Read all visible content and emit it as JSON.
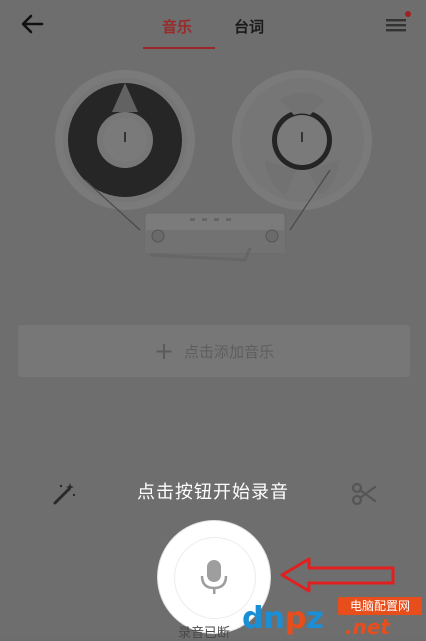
{
  "header": {
    "tabs": [
      {
        "label": "音乐",
        "active": true
      },
      {
        "label": "台词",
        "active": false
      }
    ]
  },
  "add_music": {
    "label": "点击添加音乐"
  },
  "record": {
    "hint": "点击按钮开始录音",
    "status": "录音已断"
  },
  "watermark": {
    "logo_parts": [
      "dn",
      "p",
      "z"
    ],
    "suffix": ".net",
    "site_name": "电脑配置网"
  },
  "colors": {
    "accent": "#9a2a2a",
    "overlay": "#6e6e6e",
    "arrow": "#e02020",
    "watermark_orange": "#e84e1b",
    "watermark_blue": "#1a8fd6"
  },
  "icons": [
    "back-arrow-icon",
    "menu-icon",
    "notification-dot",
    "magic-wand-icon",
    "scissors-icon",
    "microphone-icon",
    "plus-icon"
  ]
}
